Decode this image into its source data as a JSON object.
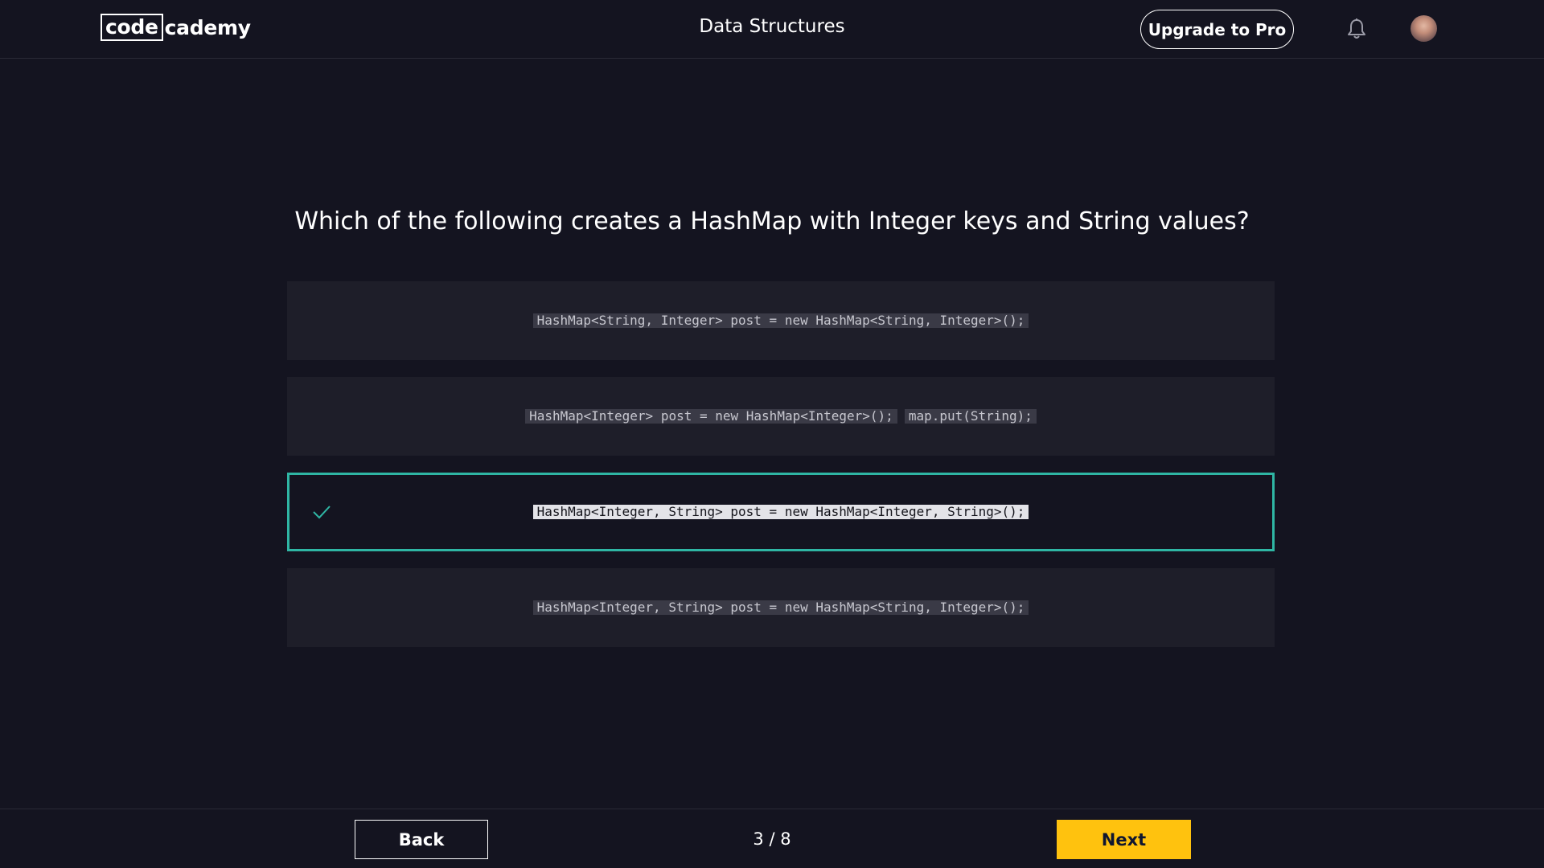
{
  "header": {
    "logo_code": "code",
    "logo_cademy": "cademy",
    "title": "Data Structures",
    "upgrade_label": "Upgrade to Pro",
    "bell_icon": "bell-icon",
    "avatar_icon": "user-avatar"
  },
  "quiz": {
    "question": "Which of the following creates a HashMap with Integer keys and String values?",
    "options": [
      {
        "code": [
          "HashMap<String, Integer> post = new HashMap<String, Integer>();"
        ],
        "selected": false
      },
      {
        "code": [
          "HashMap<Integer> post = new HashMap<Integer>();",
          "map.put(String);"
        ],
        "selected": false
      },
      {
        "code": [
          "HashMap<Integer, String> post = new HashMap<Integer, String>();"
        ],
        "selected": true
      },
      {
        "code": [
          "HashMap<Integer, String> post = new HashMap<String, Integer>();"
        ],
        "selected": false
      }
    ]
  },
  "footer": {
    "back_label": "Back",
    "progress": "3 / 8",
    "next_label": "Next"
  },
  "colors": {
    "background": "#141420",
    "option_bg": "#1e1e29",
    "selected_border": "#2fb6a4",
    "next_button": "#ffc20e"
  }
}
